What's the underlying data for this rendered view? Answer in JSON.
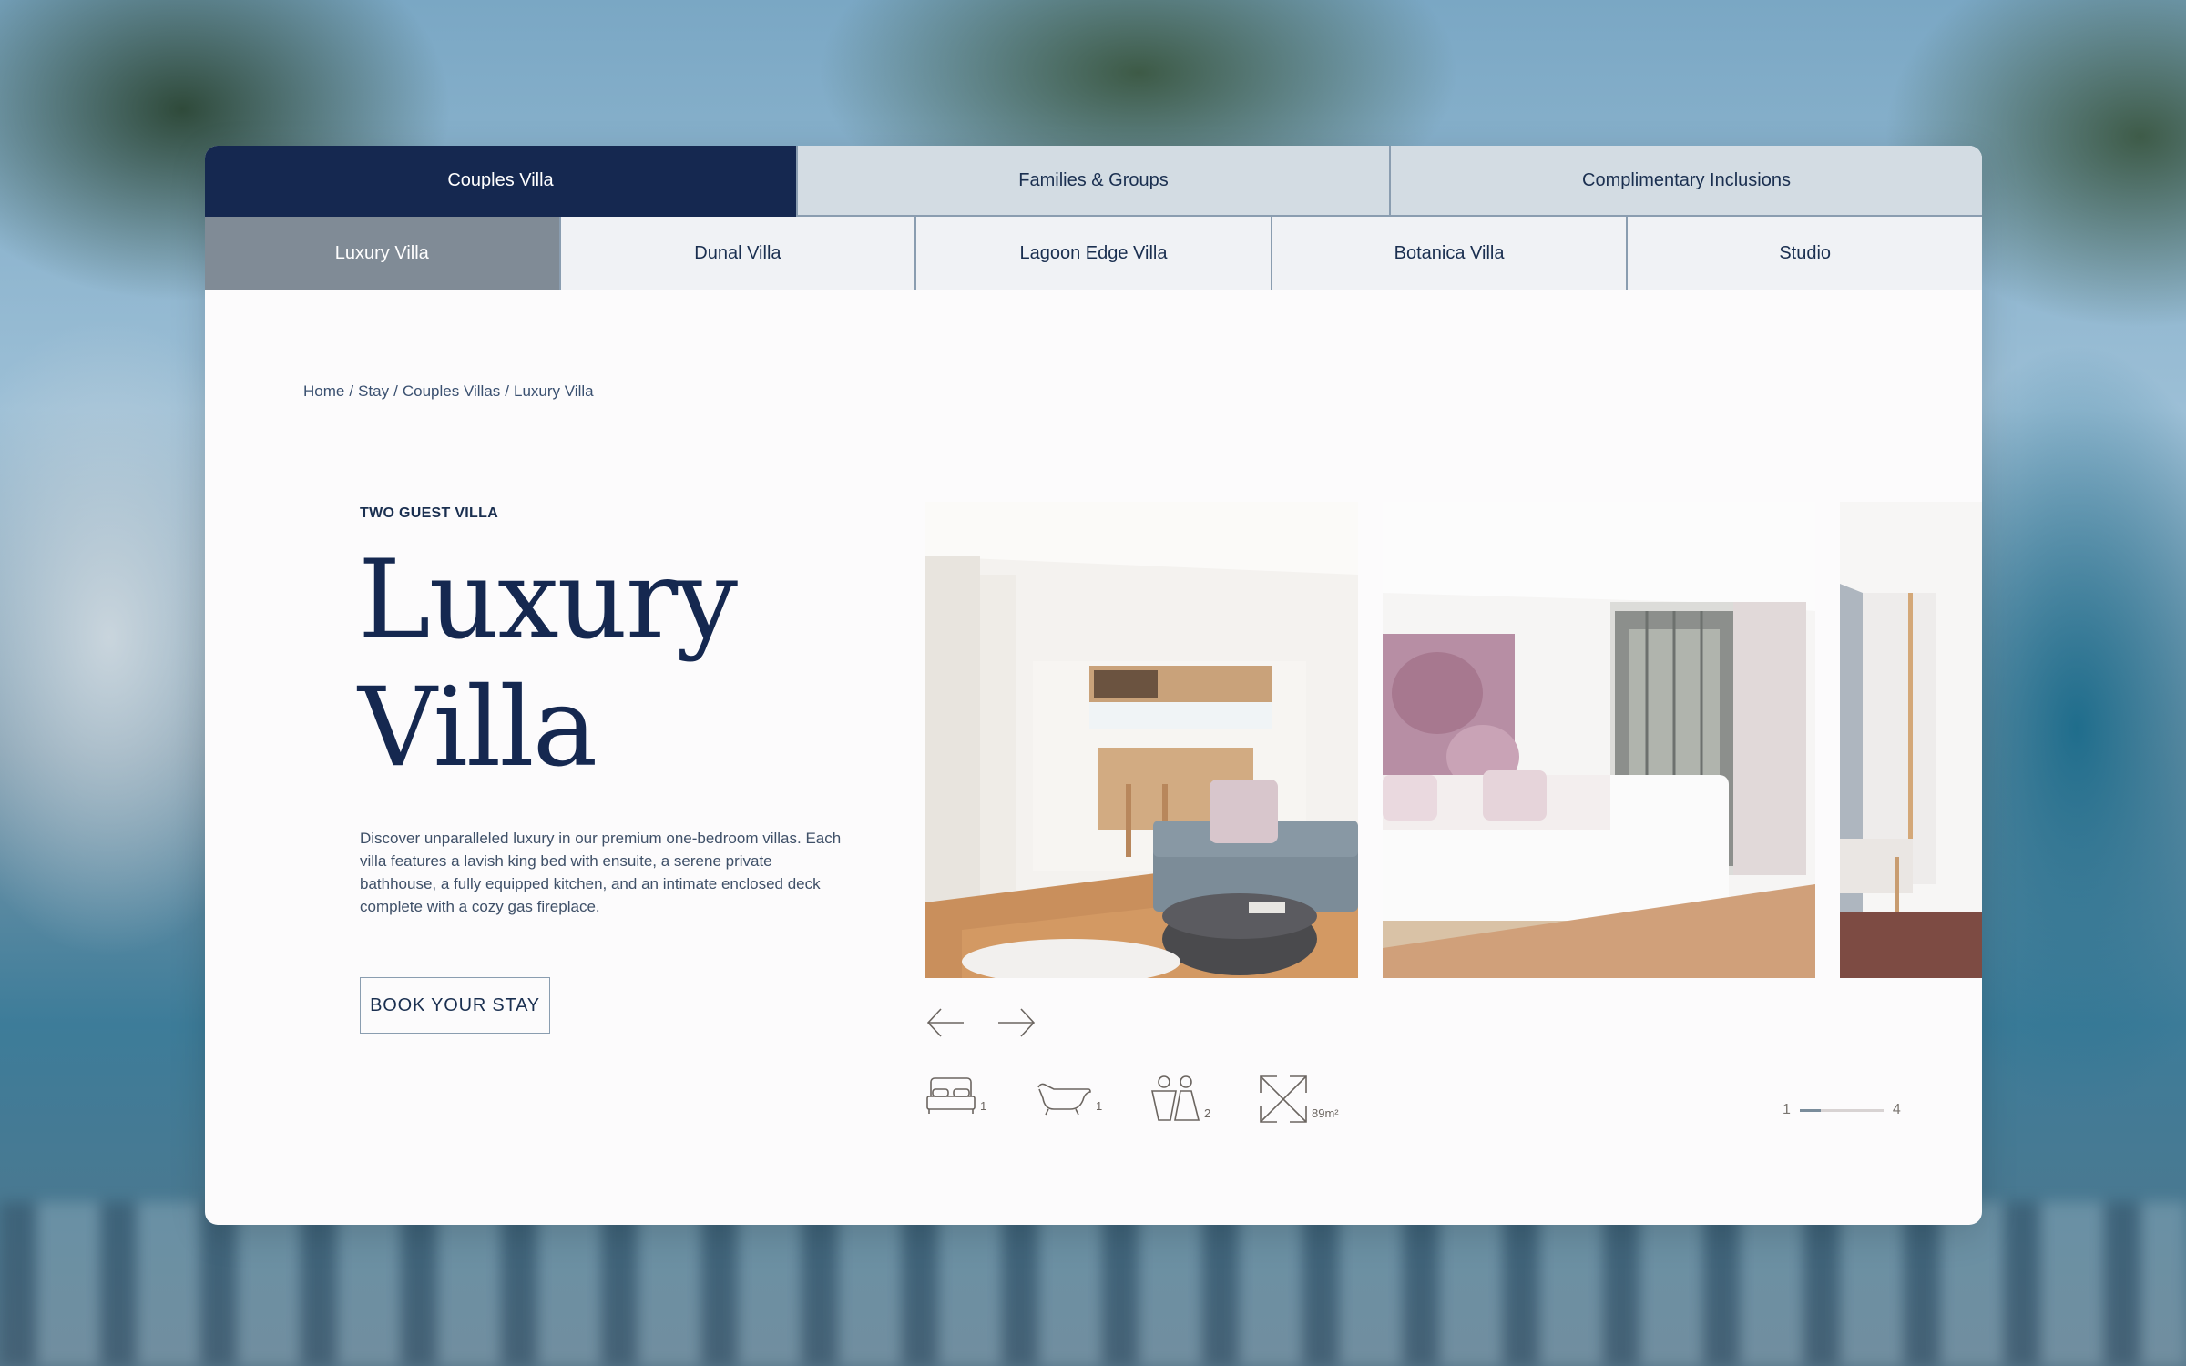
{
  "tabs_top": [
    {
      "label": "Couples Villa",
      "active": true
    },
    {
      "label": "Families & Groups",
      "active": false
    },
    {
      "label": "Complimentary Inclusions",
      "active": false
    }
  ],
  "tabs_sub": [
    {
      "label": "Luxury Villa",
      "active": true
    },
    {
      "label": "Dunal Villa",
      "active": false
    },
    {
      "label": "Lagoon Edge Villa",
      "active": false
    },
    {
      "label": "Botanica Villa",
      "active": false
    },
    {
      "label": "Studio",
      "active": false
    }
  ],
  "breadcrumb": [
    {
      "label": "Home"
    },
    {
      "label": "Stay"
    },
    {
      "label": "Couples Villas"
    },
    {
      "label": "Luxury Villa"
    }
  ],
  "breadcrumb_separator": "/",
  "villa": {
    "eyebrow": "TWO GUEST VILLA",
    "title_line1": "Luxury",
    "title_line2": "Villa",
    "description": "Discover unparalleled luxury in our premium one-bedroom villas. Each villa features a lavish king bed with ensuite, a serene private bathhouse, a fully equipped kitchen, and an intimate enclosed deck complete with a cozy gas fireplace.",
    "cta_label": "BOOK YOUR STAY"
  },
  "gallery": {
    "photos": [
      {
        "description": "Living room with kitchen, grey sofa and timber floors"
      },
      {
        "description": "Bedroom with king bed, floral artwork and floor-to-ceiling windows"
      },
      {
        "description": "Partial view of room with timber bench"
      }
    ],
    "prev_icon": "arrow-left-icon",
    "next_icon": "arrow-right-icon"
  },
  "amenities": [
    {
      "icon": "bed-icon",
      "count": "1"
    },
    {
      "icon": "bathtub-icon",
      "count": "1"
    },
    {
      "icon": "guests-icon",
      "count": "2"
    },
    {
      "icon": "floor-area-icon",
      "count": "89m²"
    }
  ],
  "pager": {
    "current": "1",
    "total": "4",
    "progress": 0.25
  },
  "colors": {
    "navy": "#152850",
    "active_sub": "#808b96",
    "tab_bg": "#d3dce3",
    "sub_bg": "#f0f2f5"
  }
}
